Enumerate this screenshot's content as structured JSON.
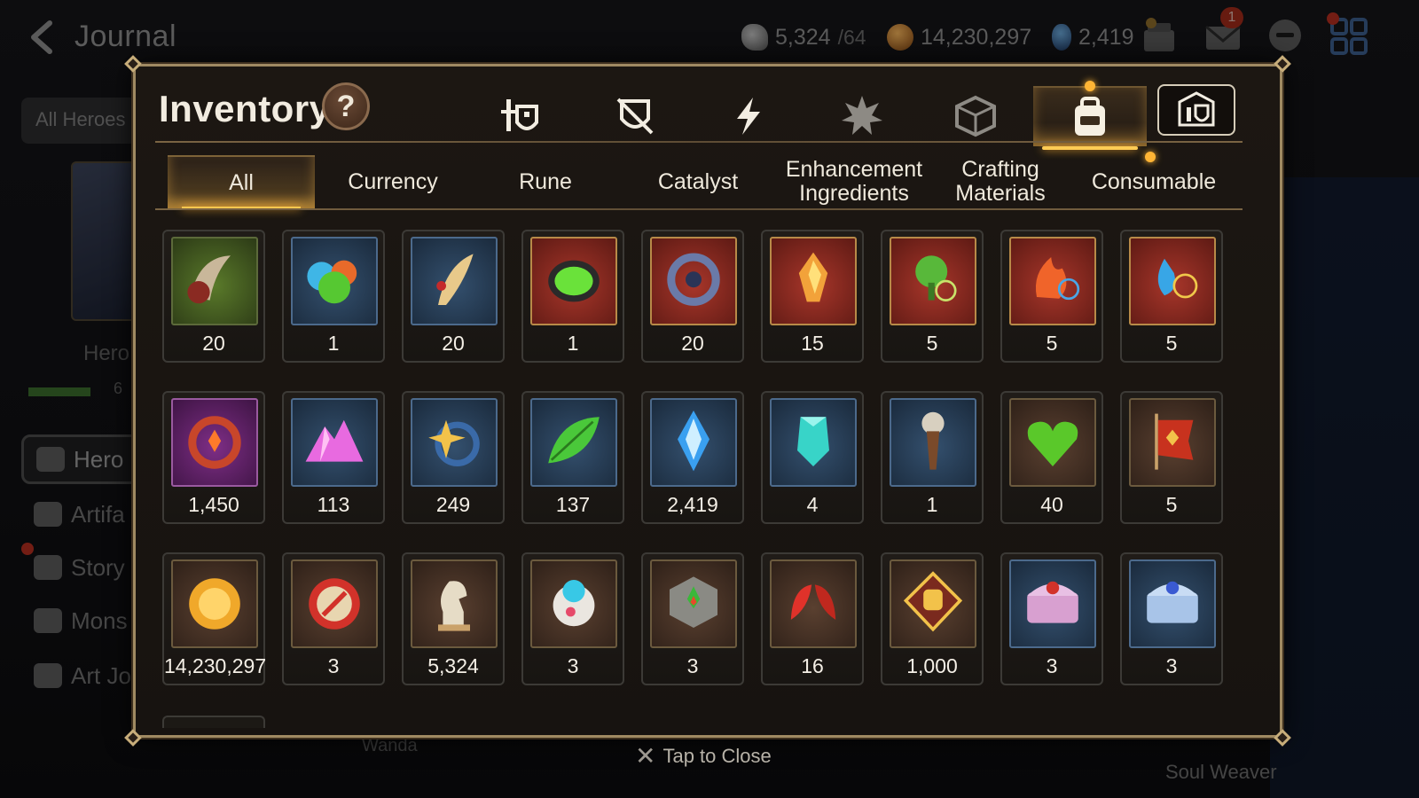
{
  "topbar": {
    "title": "Journal",
    "resources": {
      "sky": {
        "value": "5,324",
        "max": "/64"
      },
      "gold": {
        "value": "14,230,297"
      },
      "crystal": {
        "value": "2,419"
      }
    },
    "mail_badge": "1"
  },
  "background": {
    "filter_label": "All Heroes",
    "hero_label": "Hero",
    "xp_num": "6",
    "nav": [
      "Hero",
      "Artifa",
      "Story",
      "Mons",
      "Art Jo"
    ],
    "soul_weaver": "Soul Weaver",
    "wanda": "Wanda"
  },
  "inventory": {
    "title": "Inventory",
    "help": "?",
    "category_tabs": [
      {
        "name": "hero-equipment-icon"
      },
      {
        "name": "sword-shield-icon"
      },
      {
        "name": "lightning-icon"
      },
      {
        "name": "spiky-icon"
      },
      {
        "name": "cube-icon"
      },
      {
        "name": "backpack-icon",
        "active": true
      },
      {
        "name": "storage-icon"
      }
    ],
    "subtabs": [
      "All",
      "Currency",
      "Rune",
      "Catalyst",
      "Enhancement\nIngredients",
      "Crafting\nMaterials",
      "Consumable"
    ],
    "items": [
      {
        "icon": "claw-icon",
        "qty": "20",
        "bg": "green"
      },
      {
        "icon": "orbs-icon",
        "qty": "1",
        "bg": "blue"
      },
      {
        "icon": "feather-icon",
        "qty": "20",
        "bg": "blue"
      },
      {
        "icon": "green-orb-icon",
        "qty": "1",
        "bg": "red"
      },
      {
        "icon": "blue-rune-icon",
        "qty": "20",
        "bg": "red"
      },
      {
        "icon": "fire-crystal-icon",
        "qty": "15",
        "bg": "red"
      },
      {
        "icon": "tree-rune-icon",
        "qty": "5",
        "bg": "red"
      },
      {
        "icon": "fire-rune-icon",
        "qty": "5",
        "bg": "red"
      },
      {
        "icon": "water-rune-icon",
        "qty": "5",
        "bg": "red"
      },
      {
        "icon": "purple-rune-icon",
        "qty": "1,450",
        "bg": "purple"
      },
      {
        "icon": "crystal-mountain-icon",
        "qty": "113",
        "bg": "blue"
      },
      {
        "icon": "star-rune-icon",
        "qty": "249",
        "bg": "blue"
      },
      {
        "icon": "leaf-icon",
        "qty": "137",
        "bg": "blue"
      },
      {
        "icon": "sky-crystal-icon",
        "qty": "2,419",
        "bg": "blue"
      },
      {
        "icon": "teal-crystal-icon",
        "qty": "4",
        "bg": "blue"
      },
      {
        "icon": "compass-blade-icon",
        "qty": "1",
        "bg": "blue"
      },
      {
        "icon": "heart-icon",
        "qty": "40",
        "bg": "brown"
      },
      {
        "icon": "banner-icon",
        "qty": "5",
        "bg": "brown"
      },
      {
        "icon": "gold-coin-icon",
        "qty": "14,230,297",
        "bg": "brown"
      },
      {
        "icon": "red-medal-icon",
        "qty": "3",
        "bg": "brown"
      },
      {
        "icon": "chess-knight-icon",
        "qty": "5,324",
        "bg": "brown"
      },
      {
        "icon": "robot-pet-icon",
        "qty": "3",
        "bg": "brown"
      },
      {
        "icon": "stone-cube-icon",
        "qty": "3",
        "bg": "brown"
      },
      {
        "icon": "red-leaves-icon",
        "qty": "16",
        "bg": "brown"
      },
      {
        "icon": "fist-badge-icon",
        "qty": "1,000",
        "bg": "brown"
      },
      {
        "icon": "pink-chest-icon",
        "qty": "3",
        "bg": "blue"
      },
      {
        "icon": "blue-chest-icon",
        "qty": "3",
        "bg": "blue"
      }
    ],
    "close_hint": "Tap to Close"
  },
  "colors": {
    "accent_gold": "#ffcc55",
    "frame_border": "#a08a62"
  }
}
